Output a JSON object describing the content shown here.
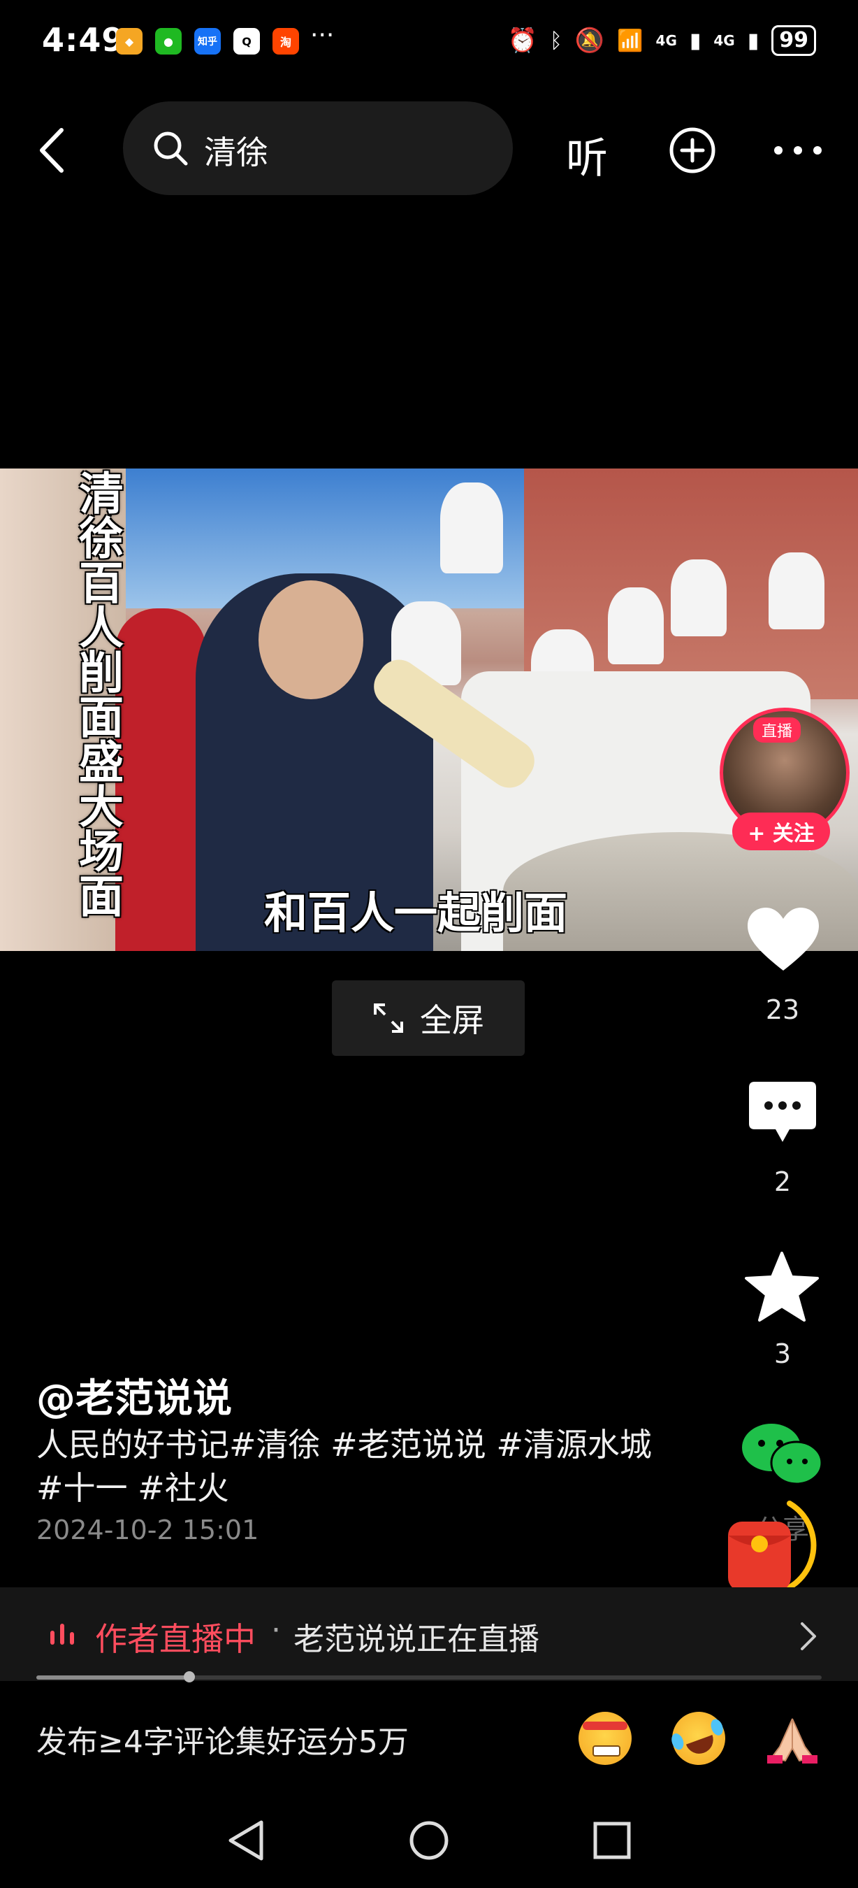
{
  "status_bar": {
    "time": "4:49",
    "apps": [
      {
        "icon": "app-yellow-icon",
        "glyph": "◆",
        "color": "#f5a623"
      },
      {
        "icon": "wechat-icon",
        "glyph": "●",
        "color": "#1fb922"
      },
      {
        "icon": "zhihu-icon",
        "glyph": "知乎",
        "color": "#1772f6"
      },
      {
        "icon": "qq-icon",
        "glyph": "Q",
        "color": "#ffffff"
      },
      {
        "icon": "taobao-icon",
        "glyph": "淘",
        "color": "#ff4400"
      }
    ],
    "more": "···",
    "signal_1": "4G",
    "signal_2": "4G",
    "battery": "99"
  },
  "top_bar": {
    "search_text": "清徐",
    "listen_label": "听"
  },
  "video": {
    "vertical_caption": "清徐百人削面盛大场面",
    "bottom_caption": "和百人一起削面",
    "live_tag": "直播",
    "follow_label": "+ 关注"
  },
  "fullscreen": {
    "label": "全屏"
  },
  "actions": {
    "like_count": "23",
    "comment_count": "2",
    "favorite_count": "3",
    "share_label": "分享"
  },
  "post": {
    "author": "@老范说说",
    "description": "人民的好书记#清徐 #老范说说 #清源水城 #十一 #社火",
    "date": "2024-10-2 15:01"
  },
  "live_banner": {
    "label": "作者直播中",
    "separator": "·",
    "text": "老范说说正在直播"
  },
  "progress": {
    "fraction": 0.195
  },
  "comment_bar": {
    "prompt": "发布≥4字评论集好运分5万",
    "emojis": [
      "grimace-emoji-icon",
      "laughing-crying-emoji-icon",
      "praying-hands-emoji-icon"
    ]
  },
  "colors": {
    "accent": "#fe2c55",
    "live_red": "#ff4d5e",
    "background": "#000000"
  }
}
